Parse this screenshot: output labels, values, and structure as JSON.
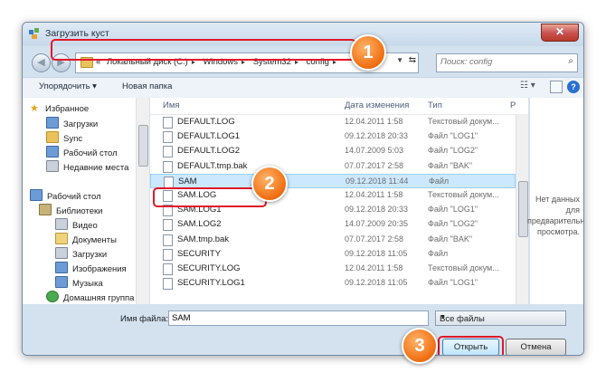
{
  "window": {
    "title": "Загрузить куст",
    "close_label": "✕"
  },
  "address": {
    "prefix": "«",
    "crumbs": [
      "Локальный диск (C:)",
      "Windows",
      "System32",
      "config"
    ],
    "separator": "▸"
  },
  "search": {
    "placeholder": "Поиск: config"
  },
  "toolbar": {
    "organize_label": "Упорядочить ▾",
    "new_folder_label": "Новая папка",
    "help_label": "?"
  },
  "sidebar": {
    "favorites_label": "Избранное",
    "favorites": [
      "Загрузки",
      "Sync",
      "Рабочий стол",
      "Недавние места"
    ],
    "desktop_label": "Рабочий стол",
    "libraries_label": "Библиотеки",
    "libraries": [
      "Видео",
      "Документы",
      "Загрузки",
      "Изображения",
      "Музыка"
    ],
    "homegroup_label": "Домашняя группа"
  },
  "columns": {
    "name": "Имя",
    "date": "Дата изменения",
    "type": "Тип",
    "extra": "Р"
  },
  "files": [
    {
      "name": "DEFAULT.LOG",
      "date": "12.04.2011 1:58",
      "type": "Текстовый докум..."
    },
    {
      "name": "DEFAULT.LOG1",
      "date": "09.12.2018 20:33",
      "type": "Файл \"LOG1\""
    },
    {
      "name": "DEFAULT.LOG2",
      "date": "14.07.2009 5:03",
      "type": "Файл \"LOG2\""
    },
    {
      "name": "DEFAULT.tmp.bak",
      "date": "07.07.2017 2:58",
      "type": "Файл \"BAK\""
    },
    {
      "name": "SAM",
      "date": "09.12.2018 11:44",
      "type": "Файл"
    },
    {
      "name": "SAM.LOG",
      "date": "12.04.2011 1:58",
      "type": "Текстовый докум..."
    },
    {
      "name": "SAM.LOG1",
      "date": "09.12.2018 20:33",
      "type": "Файл \"LOG1\""
    },
    {
      "name": "SAM.LOG2",
      "date": "14.07.2009 20:35",
      "type": "Файл \"LOG2\""
    },
    {
      "name": "SAM.tmp.bak",
      "date": "07.07.2017 2:58",
      "type": "Файл \"BAK\""
    },
    {
      "name": "SECURITY",
      "date": "09.12.2018 11:05",
      "type": "Файл"
    },
    {
      "name": "SECURITY.LOG",
      "date": "12.04.2011 1:58",
      "type": "Текстовый докум..."
    },
    {
      "name": "SECURITY.LOG1",
      "date": "09.12.2018 11:05",
      "type": "Файл \"LOG1\""
    }
  ],
  "selected_file": "SAM",
  "preview": {
    "text": "Нет данных для предварительного просмотра."
  },
  "footer": {
    "filename_label": "Имя файла:",
    "filename_value": "SAM",
    "filetype_value": "Все файлы",
    "open_label": "Открыть",
    "cancel_label": "Отмена"
  },
  "badges": [
    "1",
    "2",
    "3"
  ],
  "colors": {
    "highlight_red": "#e0182a",
    "badge_orange": "#f06d10",
    "selection": "#cce8ff"
  }
}
